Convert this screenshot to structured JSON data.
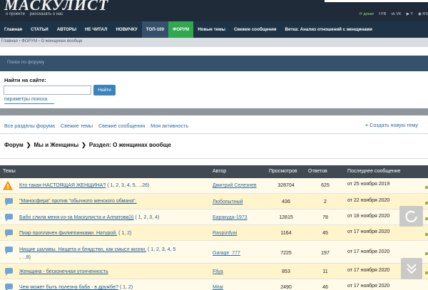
{
  "header": {
    "logo": "МАСКУЛИСТ",
    "about": "о проекте",
    "tell": "рассказать о нас",
    "donate": "донат",
    "social": [
      "FB",
      "VK",
      "Y",
      "RS"
    ]
  },
  "nav": {
    "items": [
      {
        "label": "Главная"
      },
      {
        "label": "СТАТЬИ"
      },
      {
        "label": "АВТОРЫ"
      },
      {
        "label": "НЕ ЧИТАЛ"
      },
      {
        "label": "НОВИЧКУ"
      },
      {
        "label": "ТОП-100"
      },
      {
        "label": "ФОРУМ"
      },
      {
        "label": "Новые темы"
      },
      {
        "label": "Свежие сообщения"
      },
      {
        "label": "Ветка: Анализ отношений с женщинами"
      }
    ]
  },
  "breadcrumb": {
    "home": "Главная",
    "forum": "ФОРУМ",
    "current": "О женщинах вообще"
  },
  "search_strip": "Поиск по форуму",
  "search": {
    "label": "Найти на сайте:",
    "button": "Найти",
    "params": "параметры поиска"
  },
  "filters": {
    "all": "Все разделы форума",
    "fresh_topics": "Свежие темы",
    "fresh_posts": "Свежие сообщения",
    "activity": "Моя активность",
    "create": "Создать новую тему"
  },
  "path": {
    "forum": "Форум",
    "section": "Мы и Женщины",
    "current": "Раздел: О женщинах вообще"
  },
  "table": {
    "headers": [
      "Темы",
      "Автор",
      "Просмотров",
      "Ответов",
      "Последнее сообщение"
    ],
    "rows": [
      {
        "title": "Кто такая НАСТОЯЩАЯ ЖЕНЩИНА?",
        "pages": "( 1, 2, 3, 4, 5, ...26)",
        "author": "Дмитрий Селезнев",
        "views": "328704",
        "replies": "625",
        "last": "от 25 ноября 2019",
        "icon": "warning"
      },
      {
        "title": "\"Маносфера\" против \"обычного женского обмана\".",
        "pages": "",
        "author": "Любопытный",
        "views": "436",
        "replies": "2",
        "last": "от 22 ноября 2020",
        "icon": "chat"
      },
      {
        "title": "Бабо слила меня из-за Маскулиста и Алпатова)))",
        "pages": "( 1, 2, 3, 4)",
        "author": "Баракуда-1973",
        "views": "12815",
        "replies": "78",
        "last": "от 18 ноября 2020",
        "icon": "chat"
      },
      {
        "title": "Пиар проплачен филиппинками. Натурой.",
        "pages": "( 1, 2)",
        "author": "Raspizdyai",
        "views": "1164",
        "replies": "45",
        "last": "от 17 ноября 2020",
        "icon": "chat"
      },
      {
        "title": "Нищие шалавы. Нищета и блядство, как смысл жизни.",
        "pages": "( 1, 2, 3, 4, 5",
        "pages2": ", ...8)",
        "author": "Garage_777",
        "views": "7225",
        "replies": "197",
        "last": "от 17 ноября 2020",
        "icon": "chat"
      },
      {
        "title": "Женщина - бесконечная утонченность",
        "pages": "",
        "author": "Filya",
        "views": "853",
        "replies": "11",
        "last": "от 17 ноября 2020",
        "icon": "chat"
      },
      {
        "title": "Чем может быть полезна баба - в дружбе?",
        "pages": "( 1, 2)",
        "author": "Mitai",
        "views": "2490",
        "replies": "46",
        "last": "от 17 ноября 2020",
        "icon": "chat"
      }
    ]
  }
}
